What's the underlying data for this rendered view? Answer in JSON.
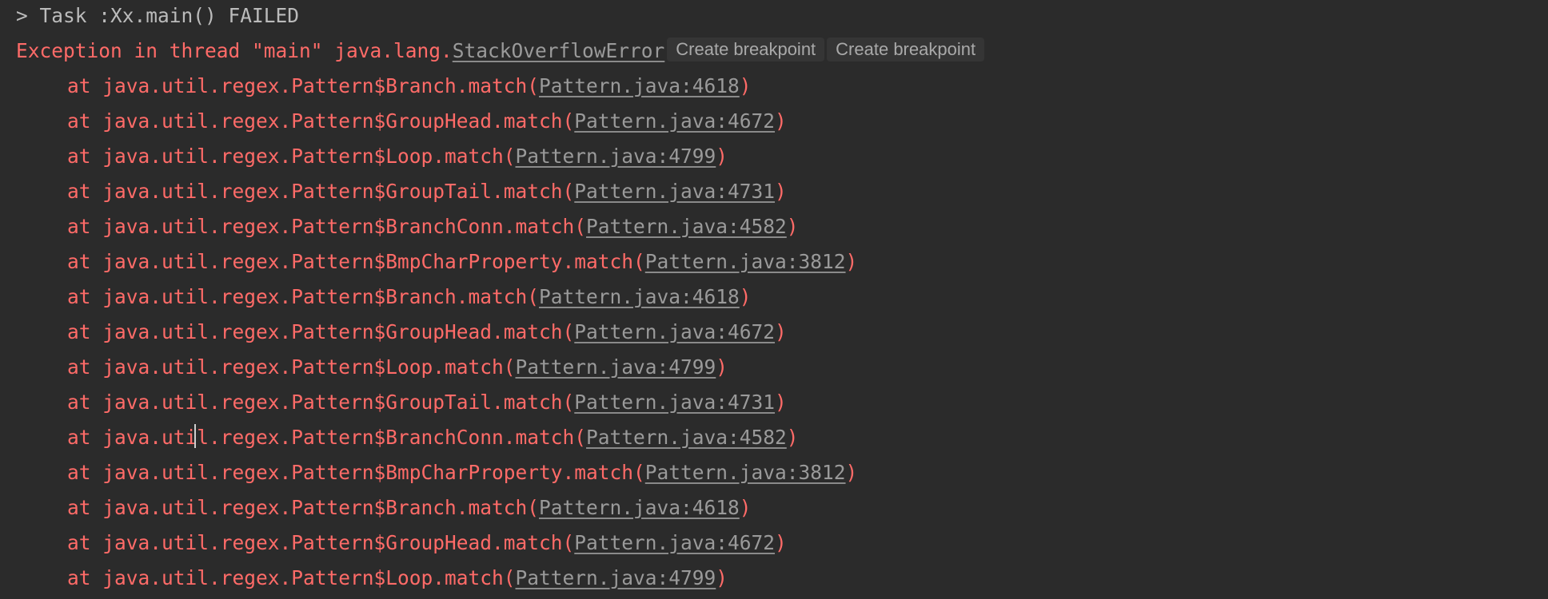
{
  "console": {
    "task_line": "> Task :Xx.main() FAILED",
    "exception": {
      "prefix": "Exception in thread \"main\" java.lang.",
      "class_link": "StackOverflowError",
      "inlay_buttons": [
        "Create breakpoint",
        "Create breakpoint"
      ]
    },
    "frames": [
      {
        "prefix": "at java.util.regex.Pattern$Branch.match(",
        "link": "Pattern.java:4618",
        "suffix": ")"
      },
      {
        "prefix": "at java.util.regex.Pattern$GroupHead.match(",
        "link": "Pattern.java:4672",
        "suffix": ")"
      },
      {
        "prefix": "at java.util.regex.Pattern$Loop.match(",
        "link": "Pattern.java:4799",
        "suffix": ")"
      },
      {
        "prefix": "at java.util.regex.Pattern$GroupTail.match(",
        "link": "Pattern.java:4731",
        "suffix": ")"
      },
      {
        "prefix": "at java.util.regex.Pattern$BranchConn.match(",
        "link": "Pattern.java:4582",
        "suffix": ")"
      },
      {
        "prefix": "at java.util.regex.Pattern$BmpCharProperty.match(",
        "link": "Pattern.java:3812",
        "suffix": ")"
      },
      {
        "prefix": "at java.util.regex.Pattern$Branch.match(",
        "link": "Pattern.java:4618",
        "suffix": ")"
      },
      {
        "prefix": "at java.util.regex.Pattern$GroupHead.match(",
        "link": "Pattern.java:4672",
        "suffix": ")"
      },
      {
        "prefix": "at java.util.regex.Pattern$Loop.match(",
        "link": "Pattern.java:4799",
        "suffix": ")"
      },
      {
        "prefix": "at java.util.regex.Pattern$GroupTail.match(",
        "link": "Pattern.java:4731",
        "suffix": ")"
      },
      {
        "prefix": "at java.util.regex.Pattern$BranchConn.match(",
        "link": "Pattern.java:4582",
        "suffix": ")"
      },
      {
        "prefix": "at java.util.regex.Pattern$BmpCharProperty.match(",
        "link": "Pattern.java:3812",
        "suffix": ")"
      },
      {
        "prefix": "at java.util.regex.Pattern$Branch.match(",
        "link": "Pattern.java:4618",
        "suffix": ")"
      },
      {
        "prefix": "at java.util.regex.Pattern$GroupHead.match(",
        "link": "Pattern.java:4672",
        "suffix": ")"
      },
      {
        "prefix": "at java.util.regex.Pattern$Loop.match(",
        "link": "Pattern.java:4799",
        "suffix": ")"
      }
    ]
  },
  "colors": {
    "background": "#2b2b2b",
    "error_text": "#ff6b68",
    "normal_text": "#bbbbbb",
    "link_text": "#9a9a9a",
    "inlay_background": "#353535"
  }
}
